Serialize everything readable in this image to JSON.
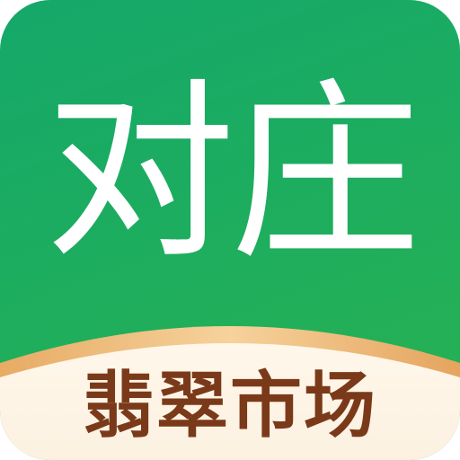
{
  "app_icon": {
    "brand_name": "对庄",
    "tagline": "翡翠市场",
    "colors": {
      "background_green": "#1fae5d",
      "arc_gold": "#f3c98e",
      "panel_cream": "#fdf4e6",
      "brand_text": "#ffffff",
      "tagline_text": "#7a3a1a"
    }
  }
}
